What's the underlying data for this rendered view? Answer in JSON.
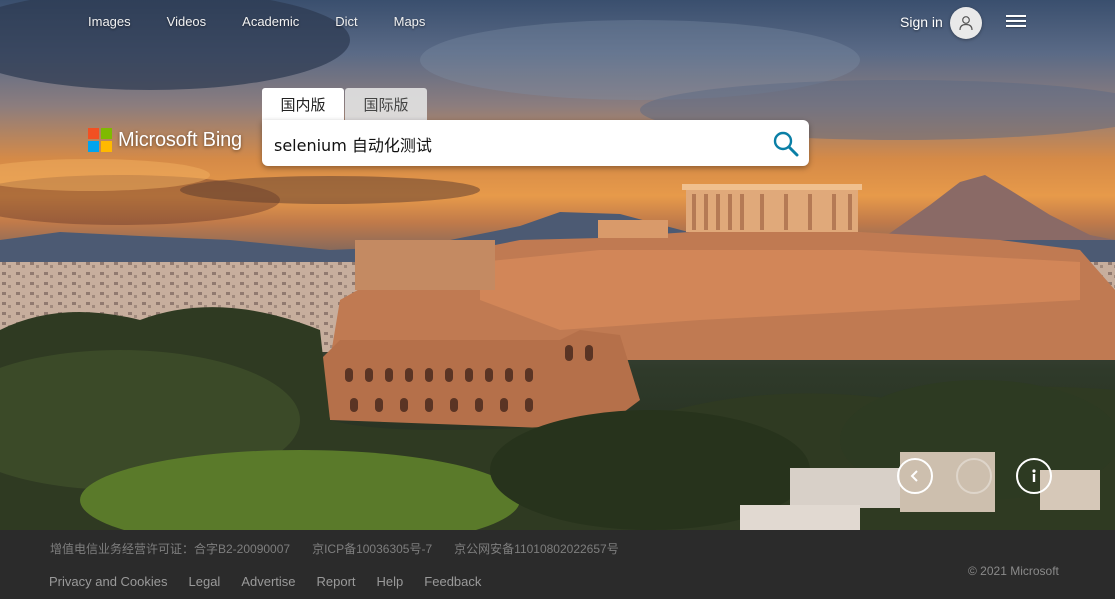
{
  "nav": {
    "items": [
      "Images",
      "Videos",
      "Academic",
      "Dict",
      "Maps"
    ],
    "signin_label": "Sign in"
  },
  "logo": {
    "text": "Microsoft Bing"
  },
  "search": {
    "tabs": [
      {
        "label": "国内版",
        "active": true
      },
      {
        "label": "国际版",
        "active": false
      }
    ],
    "query": "selenium 自动化测试"
  },
  "footer": {
    "icp": [
      "增值电信业务经营许可证：合字B2-20090007",
      "京ICP备10036305号-7",
      "京公网安备11010802022657号"
    ],
    "links": [
      "Privacy and Cookies",
      "Legal",
      "Advertise",
      "Report",
      "Help",
      "Feedback"
    ],
    "copyright": "© 2021 Microsoft"
  },
  "colors": {
    "accent": "#0a7fa6",
    "footer_bg": "#2b2b2b",
    "ms_red": "#f25022",
    "ms_green": "#7fba00",
    "ms_blue": "#00a4ef",
    "ms_yellow": "#ffb900"
  },
  "icons": [
    "search-icon",
    "user-icon",
    "hamburger-menu-icon",
    "chevron-left-icon",
    "info-icon"
  ]
}
